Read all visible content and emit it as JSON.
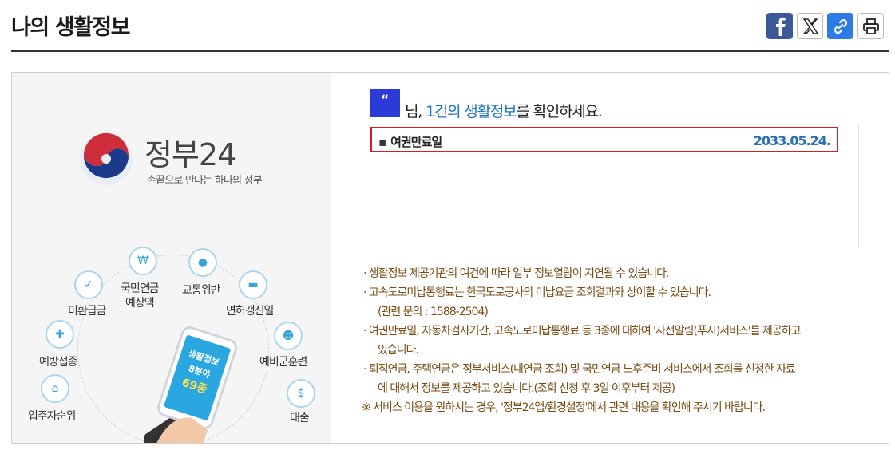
{
  "page": {
    "title": "나의 생활정보"
  },
  "share": {
    "facebook_icon": "facebook-icon",
    "x_icon": "x-icon",
    "link_icon": "link-icon",
    "print_icon": "print-icon"
  },
  "promo": {
    "brand_name": "정부24",
    "slogan": "손끝으로 만나는 하나의 정부",
    "services": [
      "미환급금",
      "국민연금\n예상액",
      "교통위반",
      "면허갱신일",
      "예방접종",
      "예비군훈련",
      "입주자순위",
      "대출"
    ],
    "phone_text": [
      "생활정보",
      "8분야",
      "69종"
    ]
  },
  "info": {
    "avatar_char": "“",
    "greeting_suffix": "님, ",
    "greeting_count": "1건의 생활정보",
    "greeting_tail": "를 확인하세요.",
    "row": {
      "label": "여권만료일",
      "value": "2033.05.24."
    },
    "notes": [
      "생활정보 제공기관의 여건에 따라 일부 정보열람이 지연될 수 있습니다.",
      "고속도로미납통행료는 한국도로공사의 미납요금 조회결과와 상이할 수 있습니다.",
      "(관련 문의 : 1588-2504)",
      "여권만료일, 자동차검사기간, 고속도로미납통행료 등 3종에 대하여 '사전알림(푸시)서비스'를 제공하고",
      "있습니다.",
      "퇴직연금, 주택연금은 정부서비스(내연금 조회) 및 국민연금 노후준비 서비스에서 조회를 신청한 자료",
      "에 대해서 정보를 제공하고 있습니다.(조회 신청 후 3일 이후부터 제공)",
      "※ 서비스 이용을 원하시는 경우, '정부24앱/환경설정'에서 관련 내용을 확인해 주시기 바랍니다."
    ]
  },
  "colors": {
    "accent": "#1a73c9",
    "highlight_border": "#d81b25",
    "note": "#7a4b12"
  }
}
